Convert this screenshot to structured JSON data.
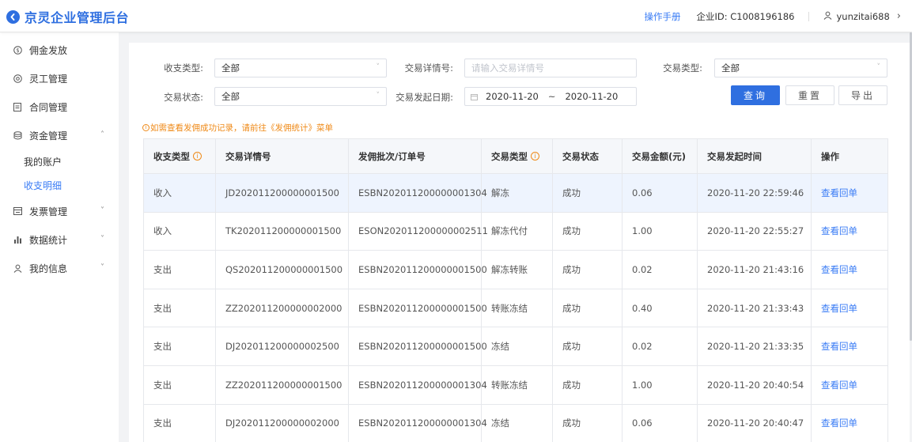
{
  "header": {
    "logo_text": "京灵企业管理后台",
    "manual_link": "操作手册",
    "company_id_label": "企业ID: C1008196186",
    "username": "yunzitai688",
    "brand_color": "#2f6fe0"
  },
  "sidebar": {
    "items": [
      {
        "label": "佣金发放",
        "icon": "dollar-circle-icon"
      },
      {
        "label": "灵工管理",
        "icon": "settings-circle-icon"
      },
      {
        "label": "合同管理",
        "icon": "document-icon"
      },
      {
        "label": "资金管理",
        "icon": "database-icon",
        "expanded": true,
        "children": [
          {
            "label": "我的账户"
          },
          {
            "label": "收支明细",
            "active": true
          }
        ]
      },
      {
        "label": "发票管理",
        "icon": "invoice-icon"
      },
      {
        "label": "数据统计",
        "icon": "bar-chart-icon"
      },
      {
        "label": "我的信息",
        "icon": "user-icon"
      }
    ]
  },
  "filters": {
    "income_type_label": "收支类型:",
    "income_type_value": "全部",
    "detail_no_label": "交易详情号:",
    "detail_no_placeholder": "请输入交易详情号",
    "tx_type_label": "交易类型:",
    "tx_type_value": "全部",
    "tx_status_label": "交易状态:",
    "tx_status_value": "全部",
    "date_label": "交易发起日期:",
    "date_start": "2020-11-20",
    "date_sep": "~",
    "date_end": "2020-11-20",
    "query_button": "查询",
    "reset_button": "重置",
    "export_button": "导出"
  },
  "notice": "如需查看发佣成功记录，请前往《发佣统计》菜单",
  "table": {
    "columns": [
      "收支类型",
      "交易详情号",
      "发佣批次/订单号",
      "交易类型",
      "交易状态",
      "交易金额(元)",
      "交易发起时间",
      "操作"
    ],
    "rows": [
      {
        "type": "收入",
        "detail": "JD202011200000001500",
        "batch": "ESBN202011200000001304",
        "tx_type": "解冻",
        "status": "成功",
        "amount": "0.06",
        "time": "2020-11-20 22:59:46",
        "action": "查看回单"
      },
      {
        "type": "收入",
        "detail": "TK202011200000001500",
        "batch": "ESON202011200000002511",
        "tx_type": "解冻代付",
        "status": "成功",
        "amount": "1.00",
        "time": "2020-11-20 22:55:27",
        "action": "查看回单"
      },
      {
        "type": "支出",
        "detail": "QS202011200000001500",
        "batch": "ESBN202011200000001500",
        "tx_type": "解冻转账",
        "status": "成功",
        "amount": "0.02",
        "time": "2020-11-20 21:43:16",
        "action": "查看回单"
      },
      {
        "type": "支出",
        "detail": "ZZ202011200000002000",
        "batch": "ESBN202011200000001500",
        "tx_type": "转账冻结",
        "status": "成功",
        "amount": "0.40",
        "time": "2020-11-20 21:33:43",
        "action": "查看回单"
      },
      {
        "type": "支出",
        "detail": "DJ202011200000002500",
        "batch": "ESBN202011200000001500",
        "tx_type": "冻结",
        "status": "成功",
        "amount": "0.02",
        "time": "2020-11-20 21:33:35",
        "action": "查看回单"
      },
      {
        "type": "支出",
        "detail": "ZZ202011200000001500",
        "batch": "ESBN202011200000001304",
        "tx_type": "转账冻结",
        "status": "成功",
        "amount": "1.00",
        "time": "2020-11-20 20:40:54",
        "action": "查看回单"
      },
      {
        "type": "支出",
        "detail": "DJ202011200000002000",
        "batch": "ESBN202011200000001304",
        "tx_type": "冻结",
        "status": "成功",
        "amount": "0.06",
        "time": "2020-11-20 20:40:47",
        "action": "查看回单"
      }
    ]
  }
}
